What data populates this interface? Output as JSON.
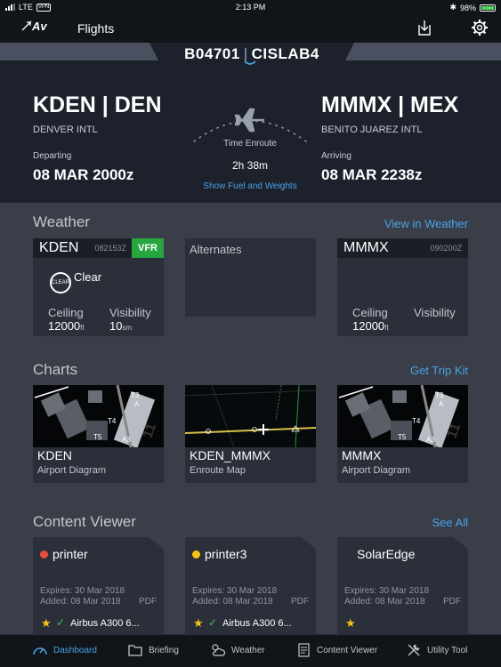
{
  "status": {
    "carrier": "LTE",
    "vpn": "VPN",
    "time": "2:13 PM",
    "battery": "98%"
  },
  "nav": {
    "title": "Flights",
    "logo": "Av"
  },
  "flight": {
    "tail": "B04701",
    "callsign": "CISLAB4",
    "separator": "|"
  },
  "origin": {
    "code": "KDEN | DEN",
    "name": "DENVER INTL",
    "time_label": "Departing",
    "time": "08 MAR 2000z"
  },
  "destination": {
    "code": "MMMX | MEX",
    "name": "BENITO JUAREZ INTL",
    "time_label": "Arriving",
    "time": "08 MAR 2238z"
  },
  "enroute": {
    "label": "Time Enroute",
    "value": "2h 38m",
    "link": "Show Fuel and Weights"
  },
  "weather": {
    "title": "Weather",
    "link": "View in Weather",
    "origin": {
      "code": "KDEN",
      "time": "082153Z",
      "category": "VFR",
      "condition_icon": "CLEAR",
      "condition": "Clear",
      "ceiling_label": "Ceiling",
      "ceiling": "12000",
      "ceiling_unit": "ft",
      "visibility_label": "Visibility",
      "visibility": "10",
      "visibility_unit": "sm"
    },
    "alternates": {
      "title": "Alternates"
    },
    "destination": {
      "code": "MMMX",
      "time": "090200Z",
      "ceiling_label": "Ceiling",
      "ceiling": "12000",
      "ceiling_unit": "ft",
      "visibility_label": "Visibility"
    }
  },
  "charts": {
    "title": "Charts",
    "link": "Get Trip Kit",
    "items": [
      {
        "code": "KDEN",
        "type": "Airport Diagram",
        "labels": [
          "T3",
          "A",
          "T4",
          "T5",
          "A3",
          "11"
        ]
      },
      {
        "code": "KDEN_MMMX",
        "type": "Enroute Map"
      },
      {
        "code": "MMMX",
        "type": "Airport Diagram",
        "labels": [
          "T3",
          "A",
          "T4",
          "T5",
          "A3",
          "11"
        ]
      }
    ]
  },
  "content": {
    "title": "Content Viewer",
    "link": "See All",
    "items": [
      {
        "name": "printer",
        "dot": "#e74c3c",
        "expires": "Expires: 30 Mar 2018",
        "added": "Added: 08 Mar 2018",
        "type": "PDF",
        "aircraft": "Airbus A300 6...",
        "star": "★",
        "check": "✓"
      },
      {
        "name": "printer3",
        "dot": "#f5c518",
        "expires": "Expires: 30 Mar 2018",
        "added": "Added: 08 Mar 2018",
        "type": "PDF",
        "aircraft": "Airbus A300 6...",
        "star": "★",
        "check": "✓"
      },
      {
        "name": "SolarEdge",
        "dot": "",
        "expires": "Expires: 30 Mar 2018",
        "added": "Added: 08 Mar 2018",
        "type": "PDF",
        "aircraft": "",
        "star": "★",
        "check": ""
      }
    ]
  },
  "tabbar": [
    {
      "label": "Dashboard",
      "icon": "dashboard-icon",
      "active": true
    },
    {
      "label": "Briefing",
      "icon": "folder-icon",
      "active": false
    },
    {
      "label": "Weather",
      "icon": "weather-icon",
      "active": false
    },
    {
      "label": "Content Viewer",
      "icon": "document-icon",
      "active": false
    },
    {
      "label": "Utility Tool",
      "icon": "tools-icon",
      "active": false
    }
  ],
  "colors": {
    "accent": "#4aa3e6",
    "vfr": "#27a53f",
    "background": "#1c212c",
    "card": "#2a2f3a"
  }
}
